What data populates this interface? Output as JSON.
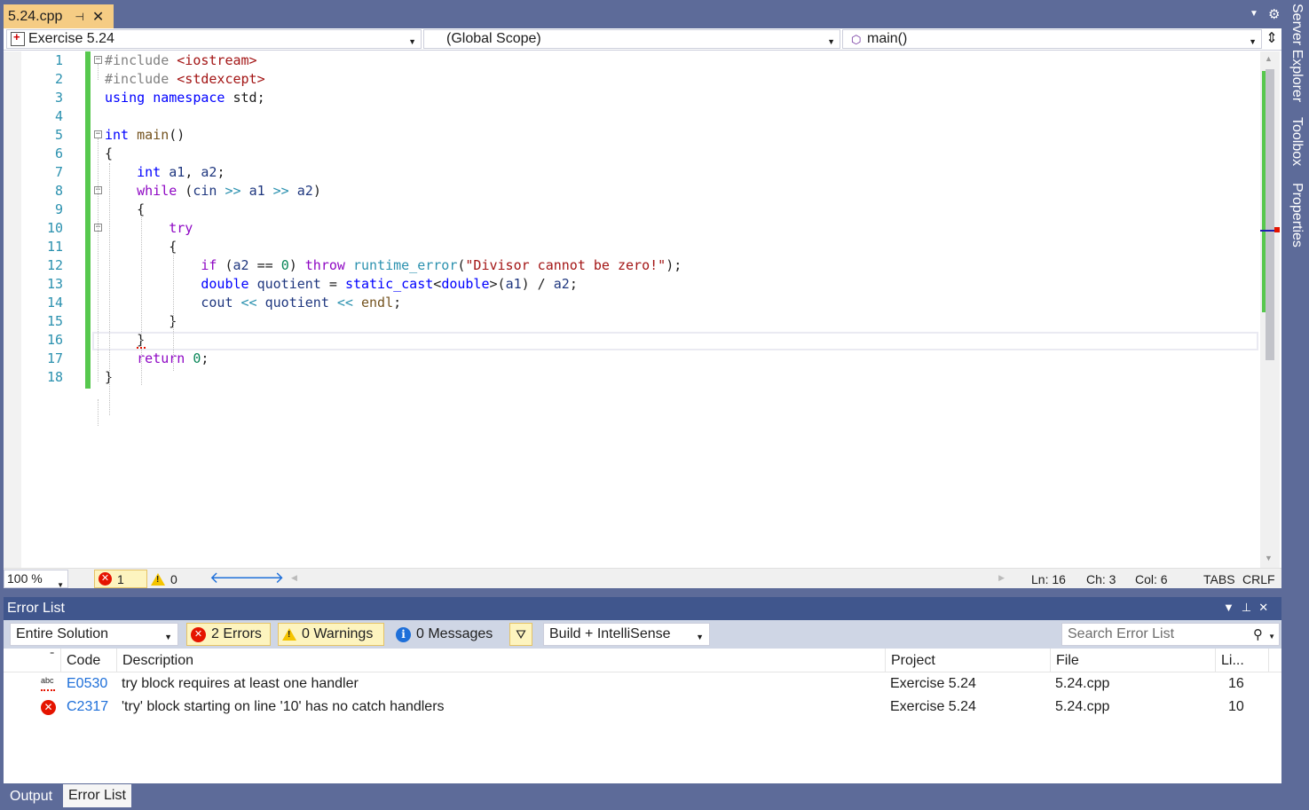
{
  "document_tab": {
    "name": "5.24.cpp",
    "pin_glyph": "⊣",
    "close_glyph": "✕"
  },
  "nav": {
    "project": "Exercise 5.24",
    "scope": "(Global Scope)",
    "member": "main()"
  },
  "code_lines": [
    {
      "n": "1",
      "html": "<span class=\"pp\">#include</span> <span class=\"inc\">&lt;iostream&gt;</span>"
    },
    {
      "n": "2",
      "html": "<span class=\"pp\">#include</span> <span class=\"inc\">&lt;stdexcept&gt;</span>"
    },
    {
      "n": "3",
      "html": "<span class=\"kw\">using</span> <span class=\"kw\">namespace</span> std;"
    },
    {
      "n": "4",
      "html": ""
    },
    {
      "n": "5",
      "html": "<span class=\"kw\">int</span> <span class=\"fn\">main</span>()"
    },
    {
      "n": "6",
      "html": "{"
    },
    {
      "n": "7",
      "html": "    <span class=\"kw\">int</span> <span class=\"vb\">a1</span>, <span class=\"vb\">a2</span>;"
    },
    {
      "n": "8",
      "html": "    <span class=\"ctl\">while</span> (<span class=\"vb\">cin</span> <span class=\"ty\">&gt;&gt;</span> <span class=\"vb\">a1</span> <span class=\"ty\">&gt;&gt;</span> <span class=\"vb\">a2</span>)"
    },
    {
      "n": "9",
      "html": "    {"
    },
    {
      "n": "10",
      "html": "        <span class=\"ctl\">try</span>"
    },
    {
      "n": "11",
      "html": "        {"
    },
    {
      "n": "12",
      "html": "            <span class=\"ctl\">if</span> (<span class=\"vb\">a2</span> == <span class=\"num\">0</span>) <span class=\"ctl\">throw</span> <span class=\"ty\">runtime_error</span>(<span class=\"str\">\"Divisor cannot be zero!\"</span>);"
    },
    {
      "n": "13",
      "html": "            <span class=\"kw\">double</span> <span class=\"vb\">quotient</span> = <span class=\"kw\">static_cast</span>&lt;<span class=\"kw\">double</span>&gt;(<span class=\"vb\">a1</span>) / <span class=\"vb\">a2</span>;"
    },
    {
      "n": "14",
      "html": "            <span class=\"vb\">cout</span> <span class=\"ty\">&lt;&lt;</span> <span class=\"vb\">quotient</span> <span class=\"ty\">&lt;&lt;</span> <span class=\"fn\">endl</span>;"
    },
    {
      "n": "15",
      "html": "        }"
    },
    {
      "n": "16",
      "html": "    }"
    },
    {
      "n": "17",
      "html": "    <span class=\"ctl\">return</span> <span class=\"num\">0</span>;"
    },
    {
      "n": "18",
      "html": "}"
    }
  ],
  "editor_status": {
    "zoom": "100 %",
    "error_count": "1",
    "warning_count": "0",
    "ln": "Ln: 16",
    "ch": "Ch: 3",
    "col": "Col: 6",
    "tabs": "TABS",
    "eol": "CRLF"
  },
  "right_dock": [
    "Server Explorer",
    "Toolbox",
    "Properties"
  ],
  "error_list": {
    "title": "Error List",
    "scope": "Entire Solution",
    "errors_btn": "2 Errors",
    "warnings_btn": "0 Warnings",
    "messages_btn": "0 Messages",
    "build_filter": "Build + IntelliSense",
    "search_placeholder": "Search Error List",
    "columns": {
      "code": "Code",
      "description": "Description",
      "project": "Project",
      "file": "File",
      "line": "Li..."
    },
    "rows": [
      {
        "icon": "intellisense-squiggle-icon",
        "code": "E0530",
        "description": "try block requires at least one handler",
        "project": "Exercise 5.24",
        "file": "5.24.cpp",
        "line": "16"
      },
      {
        "icon": "error-icon",
        "code": "C2317",
        "description": "'try' block starting on line '10' has no catch handlers",
        "project": "Exercise 5.24",
        "file": "5.24.cpp",
        "line": "10"
      }
    ]
  },
  "bottom_tabs": {
    "output": "Output",
    "error_list": "Error List"
  },
  "colors": {
    "chrome": "#5d6b99",
    "active_tab": "#f5cc84",
    "panel_title": "#40568d",
    "change_bar": "#57c84e",
    "error": "#e51400"
  }
}
